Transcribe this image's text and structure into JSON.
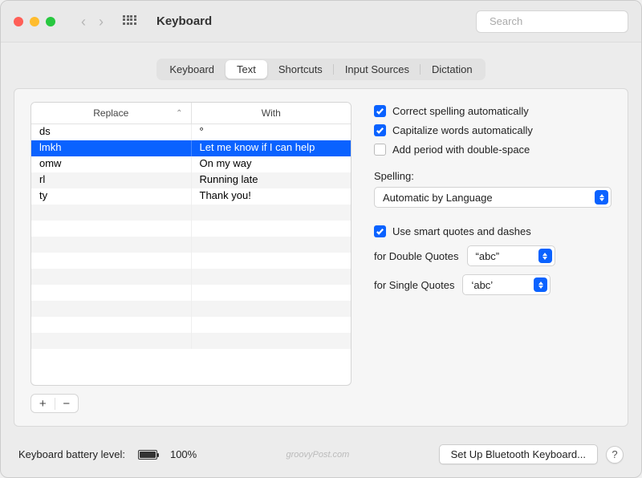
{
  "window": {
    "title": "Keyboard"
  },
  "search": {
    "placeholder": "Search"
  },
  "tabs": [
    "Keyboard",
    "Text",
    "Shortcuts",
    "Input Sources",
    "Dictation"
  ],
  "active_tab": 1,
  "table": {
    "headers": {
      "replace": "Replace",
      "with": "With"
    },
    "rows": [
      {
        "replace": "ds",
        "with": "°"
      },
      {
        "replace": "lmkh",
        "with": "Let me know if I can help"
      },
      {
        "replace": "omw",
        "with": "On my way"
      },
      {
        "replace": "rl",
        "with": "Running late"
      },
      {
        "replace": "ty",
        "with": "Thank you!"
      }
    ],
    "selected_index": 1
  },
  "options": {
    "correct_spelling": {
      "label": "Correct spelling automatically",
      "checked": true
    },
    "capitalize": {
      "label": "Capitalize words automatically",
      "checked": true
    },
    "add_period": {
      "label": "Add period with double-space",
      "checked": false
    },
    "spelling_label": "Spelling:",
    "spelling_value": "Automatic by Language",
    "smart_quotes": {
      "label": "Use smart quotes and dashes",
      "checked": true
    },
    "double_label": "for Double Quotes",
    "double_value": "“abc”",
    "single_label": "for Single Quotes",
    "single_value": "‘abc’"
  },
  "footer": {
    "battery_label": "Keyboard battery level:",
    "battery_pct": "100%",
    "watermark": "groovyPost.com",
    "bluetooth_button": "Set Up Bluetooth Keyboard..."
  }
}
